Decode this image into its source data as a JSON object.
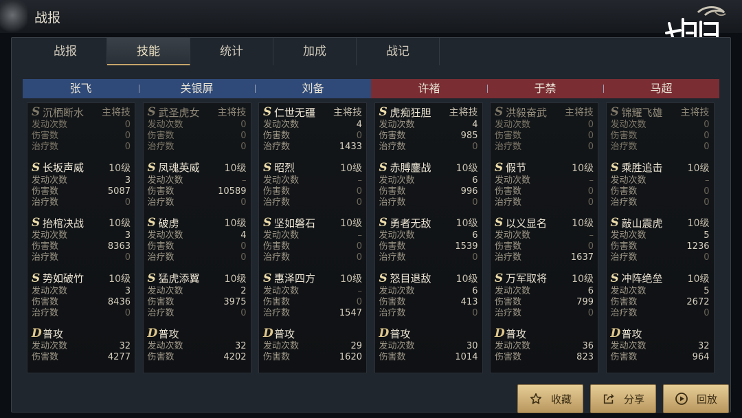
{
  "window": {
    "title": "战报"
  },
  "tabs": [
    {
      "label": "战报"
    },
    {
      "label": "技能"
    },
    {
      "label": "统计"
    },
    {
      "label": "加成"
    },
    {
      "label": "战记"
    }
  ],
  "active_tab": "技能",
  "colors": {
    "blue_team": "#2f4a78",
    "red_team": "#7a2e34",
    "accent_gold": "#c6a46a",
    "button_gold": "#e5cd96"
  },
  "heroes": [
    {
      "name": "张飞",
      "team": "blue",
      "skills": [
        {
          "grade": "S",
          "name": "沉栖断水",
          "tag": "主将技",
          "inactive": true,
          "stats": [
            [
              "发动次数",
              "0"
            ],
            [
              "伤害数",
              "0"
            ],
            [
              "治疗数",
              "0"
            ]
          ]
        },
        {
          "grade": "S",
          "name": "长坂声威",
          "tag": "10级",
          "stats": [
            [
              "发动次数",
              "3"
            ],
            [
              "伤害数",
              "5087"
            ],
            [
              "治疗数",
              "0"
            ]
          ]
        },
        {
          "grade": "S",
          "name": "抬棺决战",
          "tag": "10级",
          "stats": [
            [
              "发动次数",
              "3"
            ],
            [
              "伤害数",
              "8363"
            ],
            [
              "治疗数",
              "0"
            ]
          ]
        },
        {
          "grade": "S",
          "name": "势如破竹",
          "tag": "10级",
          "stats": [
            [
              "发动次数",
              "3"
            ],
            [
              "伤害数",
              "8436"
            ],
            [
              "治疗数",
              "0"
            ]
          ]
        },
        {
          "grade": "D",
          "name": "普攻",
          "tag": "",
          "stats": [
            [
              "发动次数",
              "32"
            ],
            [
              "伤害数",
              "4277"
            ]
          ]
        }
      ]
    },
    {
      "name": "关银屏",
      "team": "blue",
      "skills": [
        {
          "grade": "S",
          "name": "武圣虎女",
          "tag": "主将技",
          "inactive": true,
          "stats": [
            [
              "发动次数",
              "0"
            ],
            [
              "伤害数",
              "0"
            ],
            [
              "治疗数",
              "0"
            ]
          ]
        },
        {
          "grade": "S",
          "name": "凤魂英威",
          "tag": "10级",
          "stats": [
            [
              "发动次数",
              "–"
            ],
            [
              "伤害数",
              "10589"
            ],
            [
              "治疗数",
              "0"
            ]
          ]
        },
        {
          "grade": "S",
          "name": "破虏",
          "tag": "10级",
          "stats": [
            [
              "发动次数",
              "4"
            ],
            [
              "伤害数",
              "0"
            ],
            [
              "治疗数",
              "0"
            ]
          ]
        },
        {
          "grade": "S",
          "name": "猛虎添翼",
          "tag": "10级",
          "stats": [
            [
              "发动次数",
              "2"
            ],
            [
              "伤害数",
              "3975"
            ],
            [
              "治疗数",
              "0"
            ]
          ]
        },
        {
          "grade": "D",
          "name": "普攻",
          "tag": "",
          "stats": [
            [
              "发动次数",
              "32"
            ],
            [
              "伤害数",
              "4202"
            ]
          ]
        }
      ]
    },
    {
      "name": "刘备",
      "team": "blue",
      "skills": [
        {
          "grade": "S",
          "name": "仁世无疆",
          "tag": "主将技",
          "stats": [
            [
              "发动次数",
              "4"
            ],
            [
              "伤害数",
              "0"
            ],
            [
              "治疗数",
              "1433"
            ]
          ]
        },
        {
          "grade": "S",
          "name": "昭烈",
          "tag": "10级",
          "stats": [
            [
              "发动次数",
              "–"
            ],
            [
              "伤害数",
              "0"
            ],
            [
              "治疗数",
              "0"
            ]
          ]
        },
        {
          "grade": "S",
          "name": "坚如磐石",
          "tag": "10级",
          "stats": [
            [
              "发动次数",
              "–"
            ],
            [
              "伤害数",
              "0"
            ],
            [
              "治疗数",
              "0"
            ]
          ]
        },
        {
          "grade": "S",
          "name": "惠泽四方",
          "tag": "10级",
          "stats": [
            [
              "发动次数",
              "–"
            ],
            [
              "伤害数",
              "0"
            ],
            [
              "治疗数",
              "1547"
            ]
          ]
        },
        {
          "grade": "D",
          "name": "普攻",
          "tag": "",
          "stats": [
            [
              "发动次数",
              "29"
            ],
            [
              "伤害数",
              "1620"
            ]
          ]
        }
      ]
    },
    {
      "name": "许褚",
      "team": "red",
      "skills": [
        {
          "grade": "S",
          "name": "虎痴狂胆",
          "tag": "主将技",
          "stats": [
            [
              "发动次数",
              "4"
            ],
            [
              "伤害数",
              "985"
            ],
            [
              "治疗数",
              "0"
            ]
          ]
        },
        {
          "grade": "S",
          "name": "赤膊鏖战",
          "tag": "10级",
          "stats": [
            [
              "发动次数",
              "6"
            ],
            [
              "伤害数",
              "996"
            ],
            [
              "治疗数",
              "0"
            ]
          ]
        },
        {
          "grade": "S",
          "name": "勇者无敌",
          "tag": "10级",
          "stats": [
            [
              "发动次数",
              "6"
            ],
            [
              "伤害数",
              "1539"
            ],
            [
              "治疗数",
              "0"
            ]
          ]
        },
        {
          "grade": "S",
          "name": "怒目退敌",
          "tag": "10级",
          "stats": [
            [
              "发动次数",
              "6"
            ],
            [
              "伤害数",
              "413"
            ],
            [
              "治疗数",
              "0"
            ]
          ]
        },
        {
          "grade": "D",
          "name": "普攻",
          "tag": "",
          "stats": [
            [
              "发动次数",
              "30"
            ],
            [
              "伤害数",
              "1014"
            ]
          ]
        }
      ]
    },
    {
      "name": "于禁",
      "team": "red",
      "skills": [
        {
          "grade": "S",
          "name": "洪毅奋武",
          "tag": "主将技",
          "inactive": true,
          "stats": [
            [
              "发动次数",
              "0"
            ],
            [
              "伤害数",
              "0"
            ],
            [
              "治疗数",
              "0"
            ]
          ]
        },
        {
          "grade": "S",
          "name": "假节",
          "tag": "10级",
          "stats": [
            [
              "发动次数",
              "–"
            ],
            [
              "伤害数",
              "0"
            ],
            [
              "治疗数",
              "0"
            ]
          ]
        },
        {
          "grade": "S",
          "name": "以义显名",
          "tag": "10级",
          "stats": [
            [
              "发动次数",
              "–"
            ],
            [
              "伤害数",
              "0"
            ],
            [
              "治疗数",
              "1637"
            ]
          ]
        },
        {
          "grade": "S",
          "name": "万军取将",
          "tag": "10级",
          "stats": [
            [
              "发动次数",
              "6"
            ],
            [
              "伤害数",
              "799"
            ],
            [
              "治疗数",
              "0"
            ]
          ]
        },
        {
          "grade": "D",
          "name": "普攻",
          "tag": "",
          "stats": [
            [
              "发动次数",
              "36"
            ],
            [
              "伤害数",
              "823"
            ]
          ]
        }
      ]
    },
    {
      "name": "马超",
      "team": "red",
      "skills": [
        {
          "grade": "S",
          "name": "锦耀飞雄",
          "tag": "主将技",
          "inactive": true,
          "stats": [
            [
              "发动次数",
              "0"
            ],
            [
              "伤害数",
              "0"
            ],
            [
              "治疗数",
              "0"
            ]
          ]
        },
        {
          "grade": "S",
          "name": "乘胜追击",
          "tag": "10级",
          "stats": [
            [
              "发动次数",
              "–"
            ],
            [
              "伤害数",
              "0"
            ],
            [
              "治疗数",
              "0"
            ]
          ]
        },
        {
          "grade": "S",
          "name": "敲山震虎",
          "tag": "10级",
          "stats": [
            [
              "发动次数",
              "5"
            ],
            [
              "伤害数",
              "1236"
            ],
            [
              "治疗数",
              "0"
            ]
          ]
        },
        {
          "grade": "S",
          "name": "冲阵绝垒",
          "tag": "10级",
          "stats": [
            [
              "发动次数",
              "5"
            ],
            [
              "伤害数",
              "2672"
            ],
            [
              "治疗数",
              "0"
            ]
          ]
        },
        {
          "grade": "D",
          "name": "普攻",
          "tag": "",
          "stats": [
            [
              "发动次数",
              "32"
            ],
            [
              "伤害数",
              "964"
            ]
          ]
        }
      ]
    }
  ],
  "buttons": [
    {
      "label": "收藏",
      "icon": "star-icon"
    },
    {
      "label": "分享",
      "icon": "share-icon"
    },
    {
      "label": "回放",
      "icon": "play-icon"
    }
  ]
}
